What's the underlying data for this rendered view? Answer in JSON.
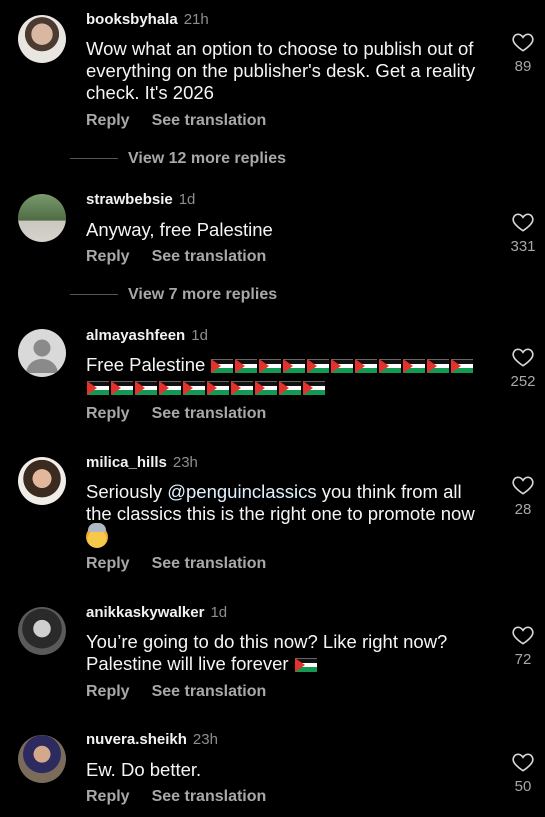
{
  "colors": {
    "background": "#000000",
    "text": "#f5f5f5",
    "secondary": "#a8a8a8",
    "mention": "#e0f1ff"
  },
  "actions": {
    "reply": "Reply",
    "translate": "See translation"
  },
  "comments": [
    {
      "user": "booksbyhala",
      "time": "21h",
      "text": "Wow what an option to choose to publish out of everything on the publisher's desk. Get a reality check. It's 2026",
      "likes": "89",
      "more_replies": "View 12 more replies"
    },
    {
      "user": "strawbebsie",
      "time": "1d",
      "text": "Anyway, free Palestine",
      "likes": "331",
      "more_replies": "View 7 more replies"
    },
    {
      "user": "almayashfeen",
      "time": "1d",
      "text": "Free Palestine",
      "likes": "252"
    },
    {
      "user": "milica_hills",
      "time": "23h",
      "text_before": "Seriously ",
      "mention": "@penguinclassics",
      "text_after": " you think from all the classics this is the right one to promote now",
      "likes": "28"
    },
    {
      "user": "anikkaskywalker",
      "time": "1d",
      "text": "You’re going to do this now? Like right now? Palestine will live forever",
      "likes": "72"
    },
    {
      "user": "nuvera.sheikh",
      "time": "23h",
      "text": "Ew. Do better.",
      "likes": "50"
    }
  ]
}
